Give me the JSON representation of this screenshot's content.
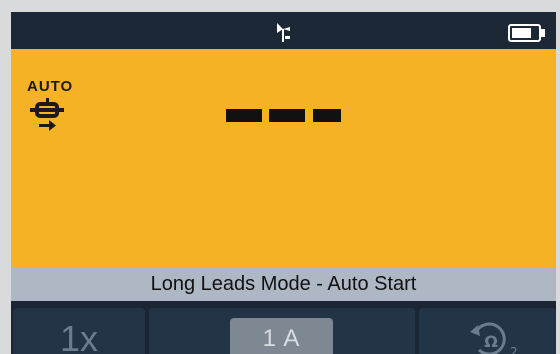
{
  "status": {
    "antenna_icon": "antenna-icon",
    "battery_icon": "battery-icon"
  },
  "main": {
    "auto_label": "AUTO",
    "leads_icon": "test-leads-icon",
    "reading": "---"
  },
  "mode": {
    "text": "Long Leads Mode - Auto Start"
  },
  "softkeys": [
    {
      "label": "1x"
    },
    {
      "label": "1 A"
    },
    {
      "icon": "ohm-swap-icon",
      "subscript": "2"
    }
  ],
  "colors": {
    "display_bg": "#f5b224",
    "frame": "#1b2634",
    "mode_bar": "#aeb8c5"
  }
}
